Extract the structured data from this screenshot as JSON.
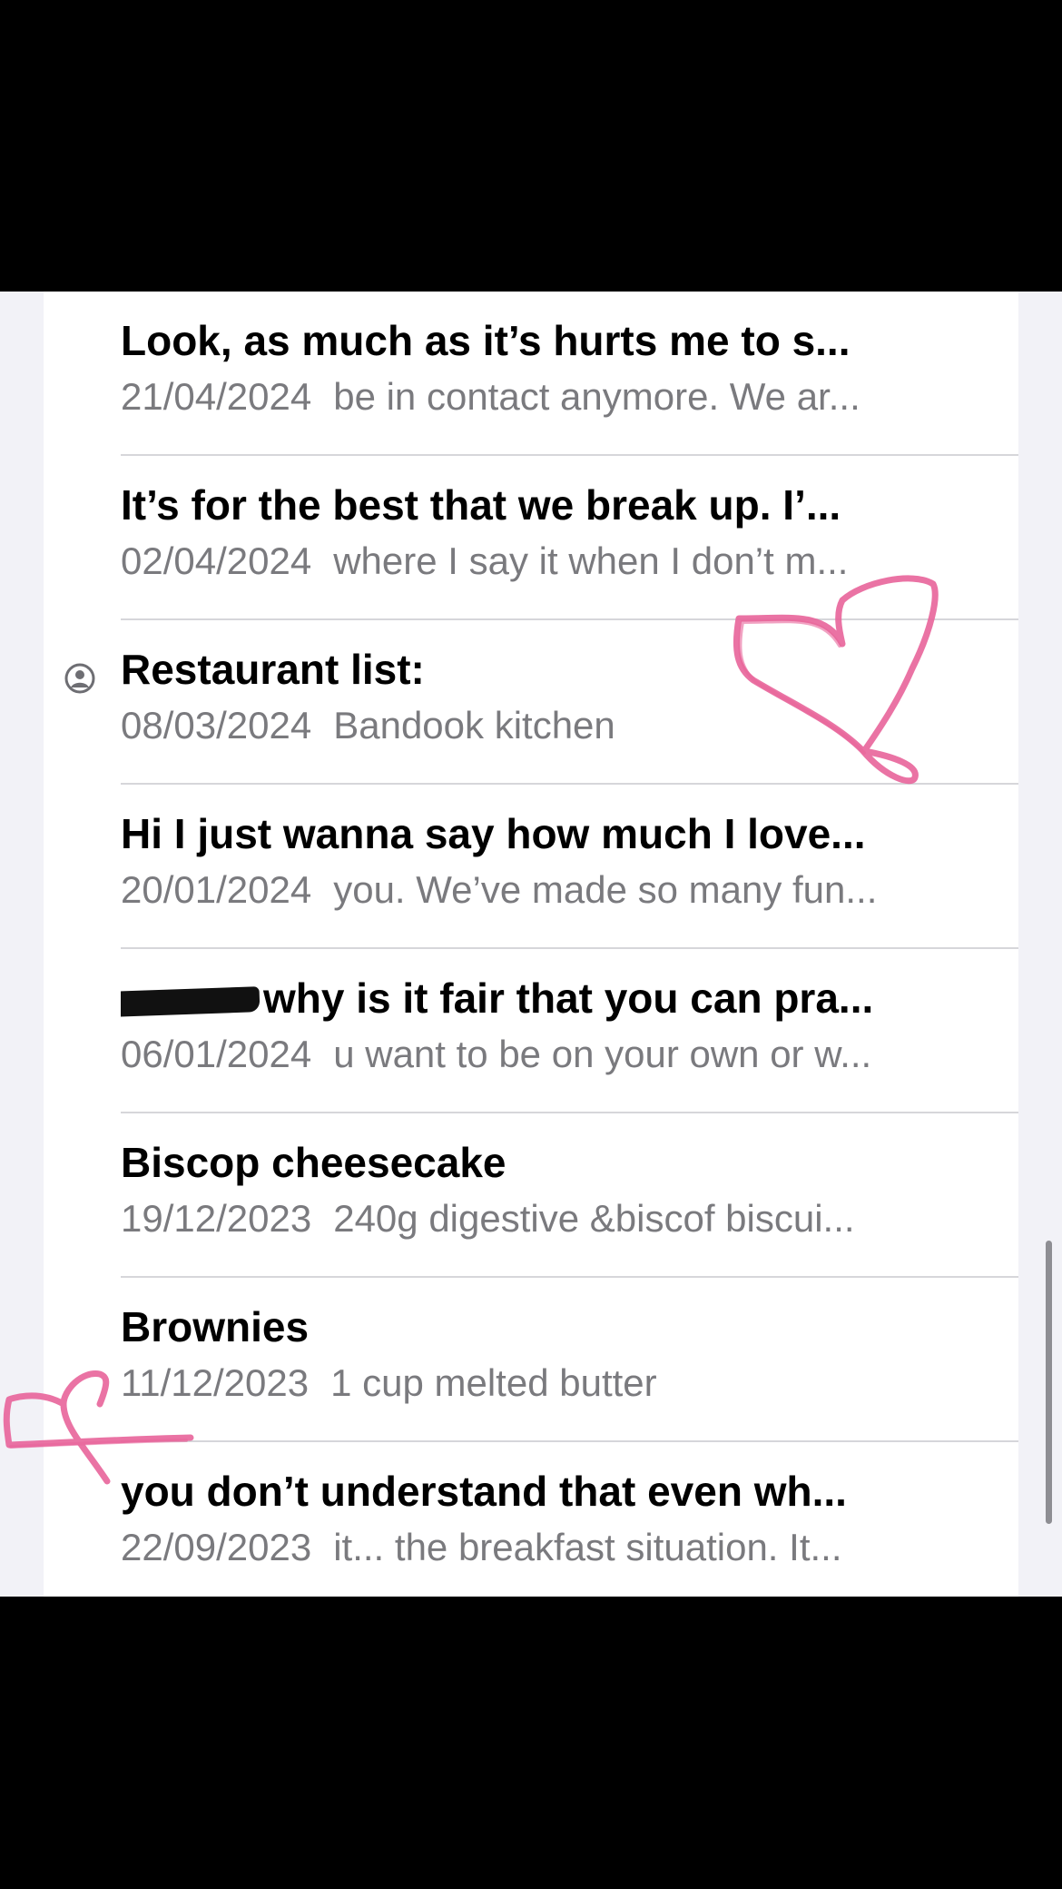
{
  "notes": [
    {
      "title": "Look, as much as it’s hurts me to s...",
      "date": "21/04/2024",
      "preview": "be in contact anymore. We ar..."
    },
    {
      "title": "It’s for the best that we break up. I’...",
      "date": "02/04/2024",
      "preview": "where I say it when I don’t m..."
    },
    {
      "title": "Restaurant list:",
      "date": "08/03/2024",
      "preview": "Bandook kitchen"
    },
    {
      "title": "Hi I just wanna say how much I love...",
      "date": "20/01/2024",
      "preview": "you. We’ve made so many fun..."
    },
    {
      "title": "why is it fair that you can pra...",
      "date": "06/01/2024",
      "preview": "u want to be on your own or w..."
    },
    {
      "title": "Biscop cheesecake",
      "date": "19/12/2023",
      "preview": "240g digestive &biscof biscui..."
    },
    {
      "title": "Brownies",
      "date": "11/12/2023",
      "preview": "1 cup melted butter"
    },
    {
      "title": "you don’t understand that even wh...",
      "date": "22/09/2023",
      "preview": "it... the breakfast situation. It..."
    }
  ],
  "icons": {
    "shared": "person-circle-icon",
    "annotation_heart": "heart-doodle-icon"
  },
  "colors": {
    "title": "#000000",
    "subtitle": "#7a7a7e",
    "doodle": "#e8649a",
    "background": "#f2f2f7"
  }
}
